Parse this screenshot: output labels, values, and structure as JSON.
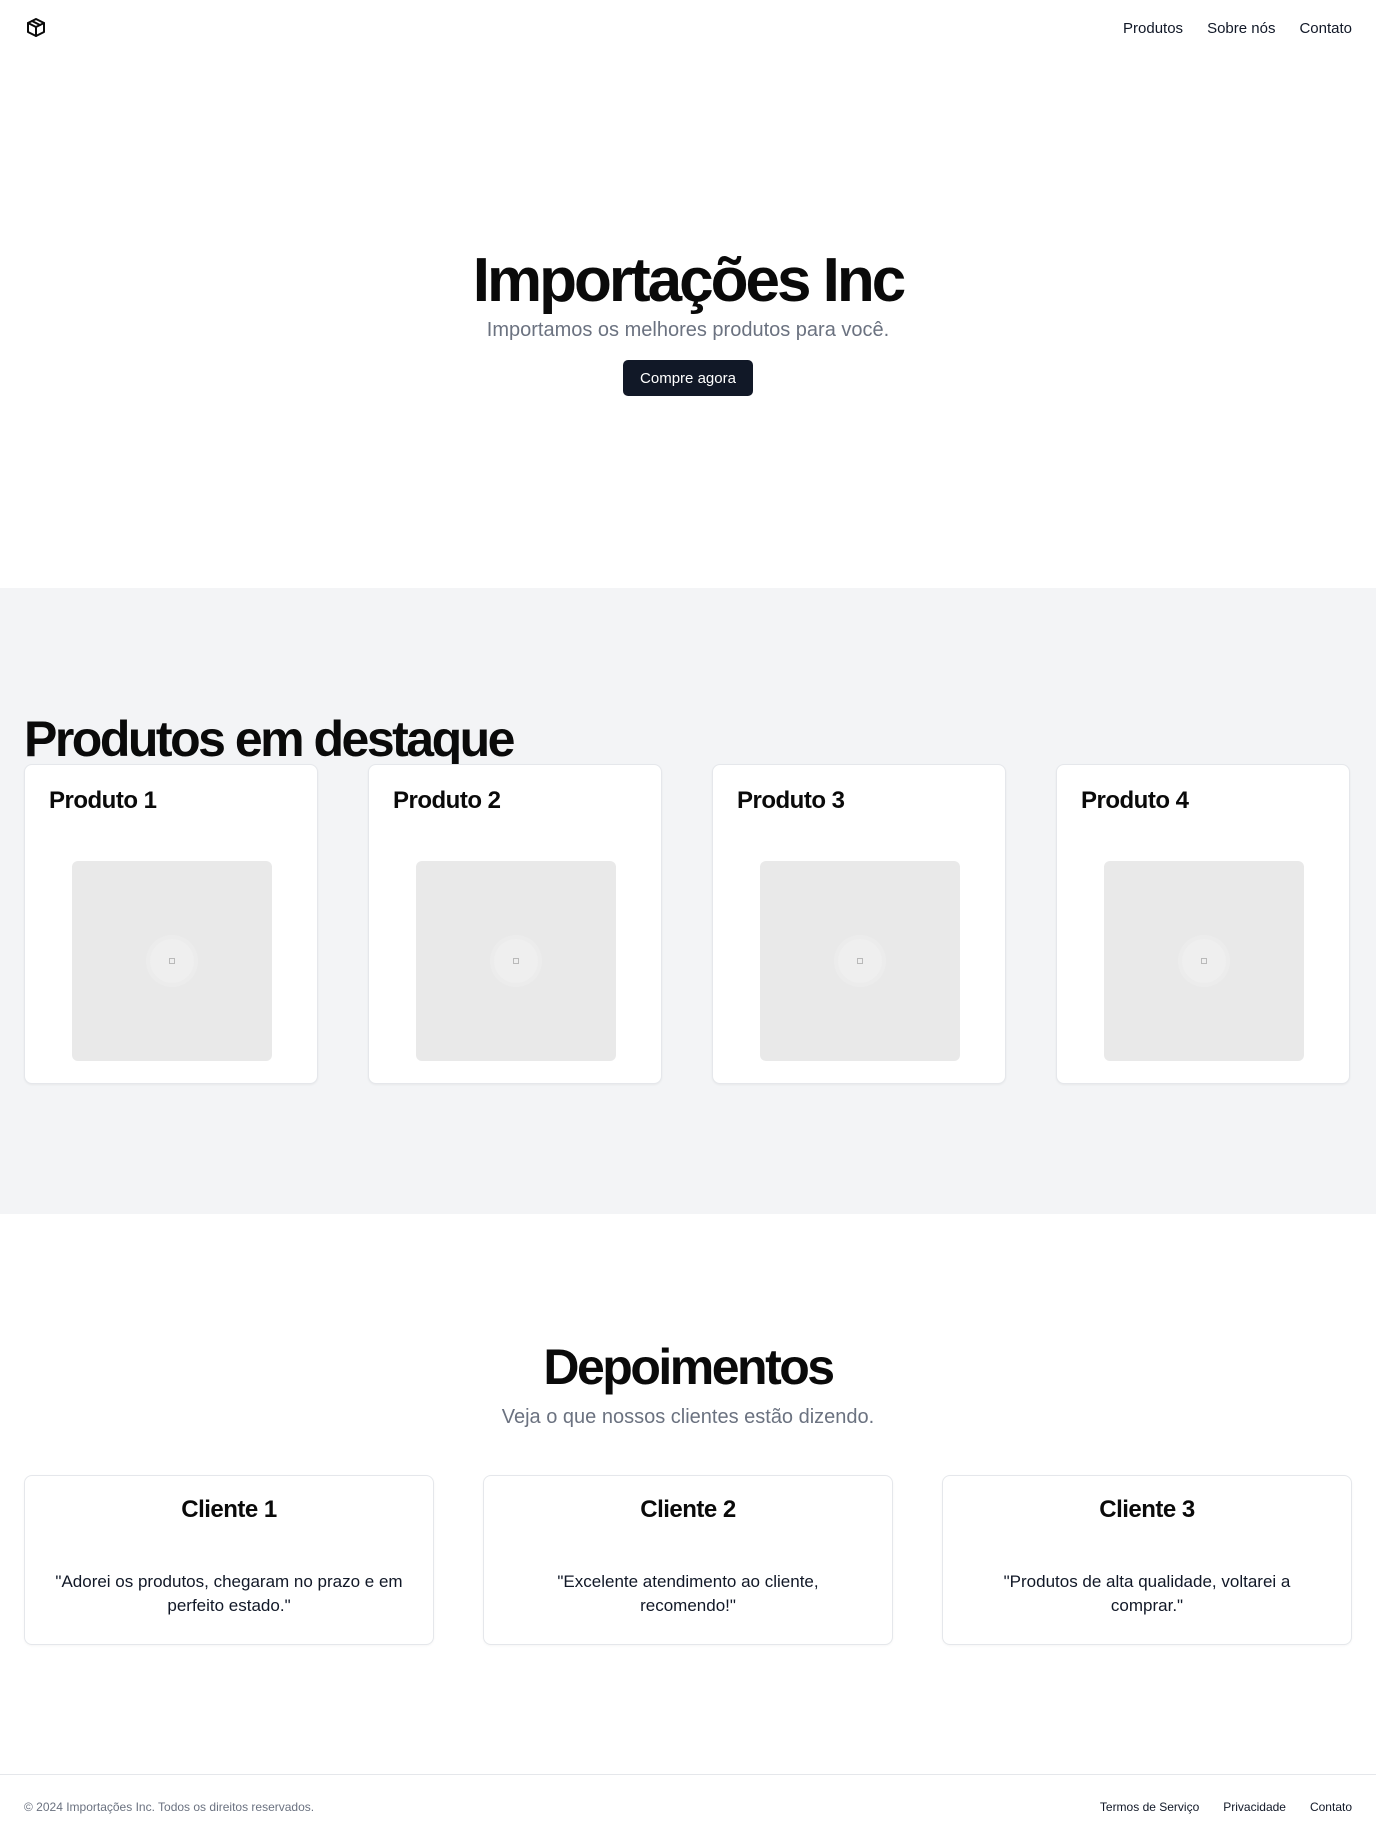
{
  "header": {
    "logo_icon": "package-icon",
    "nav": [
      {
        "label": "Produtos"
      },
      {
        "label": "Sobre nós"
      },
      {
        "label": "Contato"
      }
    ]
  },
  "hero": {
    "title": "Importações Inc",
    "subtitle": "Importamos os melhores produtos para você.",
    "cta_label": "Compre agora"
  },
  "featured": {
    "title": "Produtos em destaque",
    "products": [
      {
        "title": "Produto 1",
        "image_icon": "image-placeholder-icon"
      },
      {
        "title": "Produto 2",
        "image_icon": "image-placeholder-icon"
      },
      {
        "title": "Produto 3",
        "image_icon": "image-placeholder-icon"
      },
      {
        "title": "Produto 4",
        "image_icon": "image-placeholder-icon"
      }
    ]
  },
  "testimonials": {
    "title": "Depoimentos",
    "subtitle": "Veja o que nossos clientes estão dizendo.",
    "items": [
      {
        "name": "Cliente 1",
        "quote": "\"Adorei os produtos, chegaram no prazo e em perfeito estado.\""
      },
      {
        "name": "Cliente 2",
        "quote": "\"Excelente atendimento ao cliente, recomendo!\""
      },
      {
        "name": "Cliente 3",
        "quote": "\"Produtos de alta qualidade, voltarei a comprar.\""
      }
    ]
  },
  "footer": {
    "copyright": "© 2024 Importações Inc. Todos os direitos reservados.",
    "links": [
      {
        "label": "Termos de Serviço"
      },
      {
        "label": "Privacidade"
      },
      {
        "label": "Contato"
      }
    ]
  },
  "colors": {
    "primary_button": "#111827",
    "section_bg": "#f3f4f6",
    "muted_text": "#6b7280"
  }
}
